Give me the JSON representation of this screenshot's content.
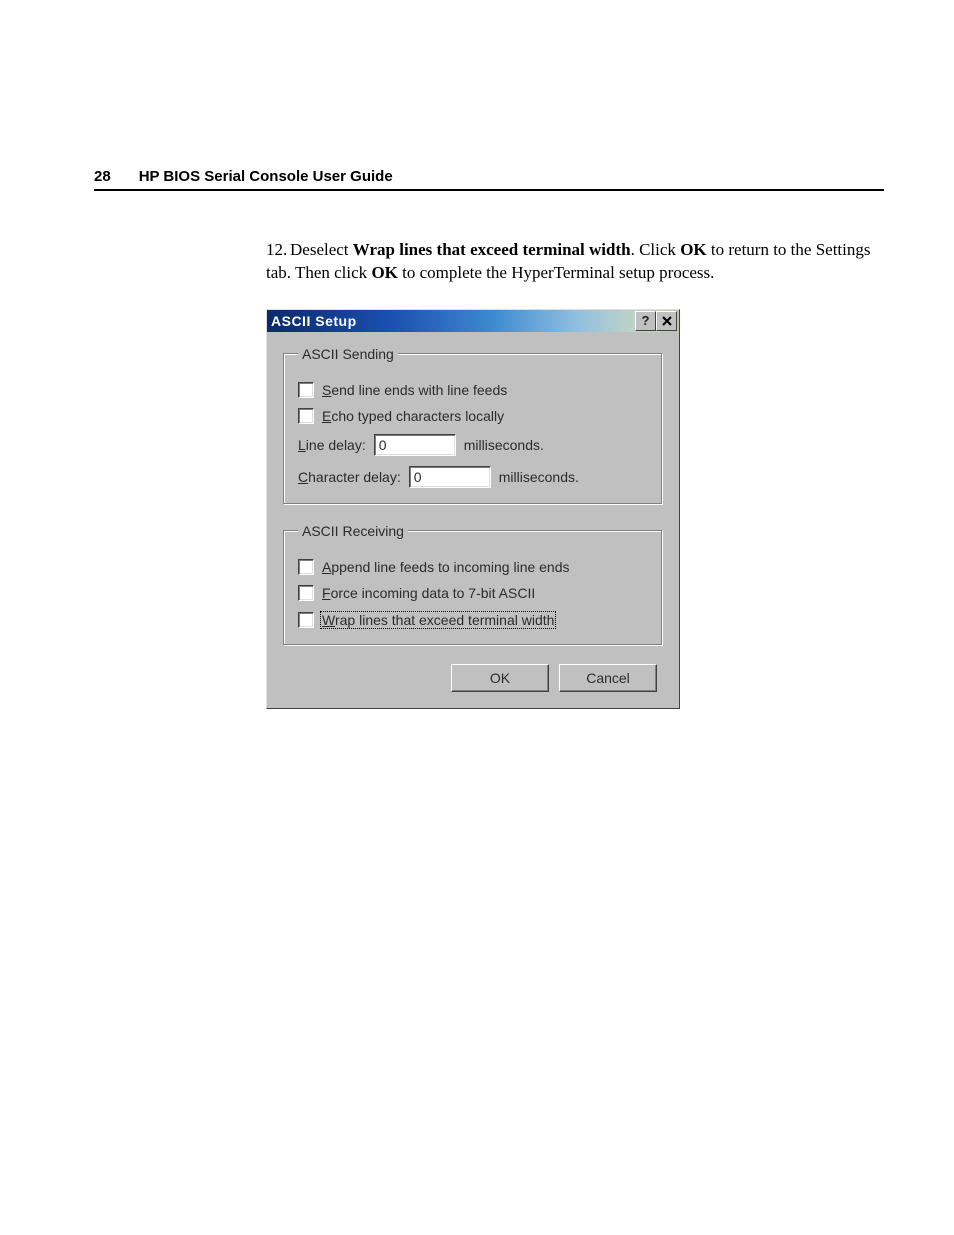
{
  "header": {
    "page_number": "28",
    "title": "HP BIOS Serial Console User Guide"
  },
  "instruction": {
    "number": "12.",
    "text_prefix": "Deselect ",
    "bold1": "Wrap lines that exceed terminal width",
    "mid1": ". Click ",
    "bold2": "OK",
    "mid2": " to return to the Settings tab. Then click ",
    "bold3": "OK",
    "suffix": " to complete the HyperTerminal setup process."
  },
  "dialog": {
    "title": "ASCII Setup",
    "titlebar": {
      "help_glyph": "?",
      "close_aria": "Close"
    },
    "sending": {
      "legend": "ASCII Sending",
      "cb_send": {
        "u": "S",
        "rest": "end line ends with line feeds"
      },
      "cb_echo": {
        "u": "E",
        "rest": "cho typed characters locally"
      },
      "line_delay": {
        "label_u": "L",
        "label_rest": "ine delay:",
        "value": "0",
        "unit": "milliseconds."
      },
      "char_delay": {
        "label_u": "C",
        "label_rest": "haracter delay:",
        "value": "0",
        "unit": "milliseconds."
      }
    },
    "receiving": {
      "legend": "ASCII Receiving",
      "cb_append": {
        "u": "A",
        "rest": "ppend line feeds to incoming line ends"
      },
      "cb_force": {
        "u": "F",
        "rest": "orce incoming data to 7-bit ASCII"
      },
      "cb_wrap": {
        "u": "W",
        "rest": "rap lines that exceed terminal width"
      }
    },
    "buttons": {
      "ok": "OK",
      "cancel": "Cancel"
    }
  }
}
